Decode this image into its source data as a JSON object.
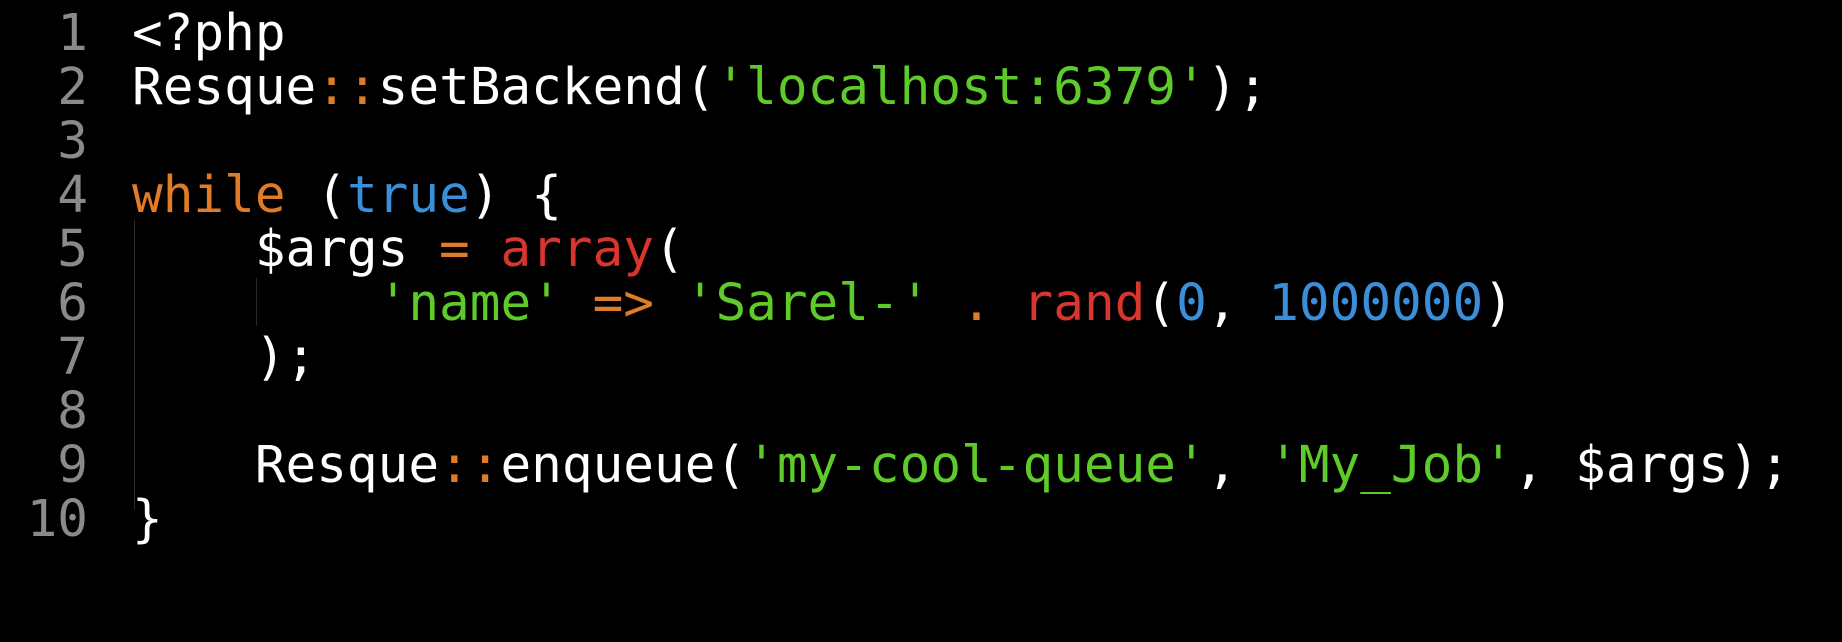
{
  "editor": {
    "colors": {
      "background": "#000000",
      "line_number": "#8a8a8a",
      "plain": "#ffffff",
      "string": "#5fcb2a",
      "keyword": "#e07b27",
      "constant": "#3a8fd8",
      "builtin_function": "#d8352e",
      "indent_guide": "#2a2a2a"
    },
    "lines": [
      {
        "number": "1",
        "tokens": [
          {
            "text": "<?php",
            "type": "plain"
          }
        ]
      },
      {
        "number": "2",
        "tokens": [
          {
            "text": "Resque",
            "type": "plain"
          },
          {
            "text": "::",
            "type": "op"
          },
          {
            "text": "setBackend(",
            "type": "plain"
          },
          {
            "text": "'localhost:6379'",
            "type": "str"
          },
          {
            "text": ");",
            "type": "plain"
          }
        ]
      },
      {
        "number": "3",
        "tokens": []
      },
      {
        "number": "4",
        "tokens": [
          {
            "text": "while",
            "type": "kw"
          },
          {
            "text": " (",
            "type": "plain"
          },
          {
            "text": "true",
            "type": "bool"
          },
          {
            "text": ") {",
            "type": "plain"
          }
        ]
      },
      {
        "number": "5",
        "tokens": [
          {
            "text": "    $args ",
            "type": "plain"
          },
          {
            "text": "=",
            "type": "op"
          },
          {
            "text": " ",
            "type": "plain"
          },
          {
            "text": "array",
            "type": "func"
          },
          {
            "text": "(",
            "type": "plain"
          }
        ]
      },
      {
        "number": "6",
        "tokens": [
          {
            "text": "        ",
            "type": "plain"
          },
          {
            "text": "'name'",
            "type": "str"
          },
          {
            "text": " ",
            "type": "plain"
          },
          {
            "text": "=>",
            "type": "op"
          },
          {
            "text": " ",
            "type": "plain"
          },
          {
            "text": "'Sarel-'",
            "type": "str"
          },
          {
            "text": " ",
            "type": "plain"
          },
          {
            "text": ".",
            "type": "op"
          },
          {
            "text": " ",
            "type": "plain"
          },
          {
            "text": "rand",
            "type": "func"
          },
          {
            "text": "(",
            "type": "plain"
          },
          {
            "text": "0",
            "type": "num"
          },
          {
            "text": ", ",
            "type": "plain"
          },
          {
            "text": "1000000",
            "type": "num"
          },
          {
            "text": ")",
            "type": "plain"
          }
        ]
      },
      {
        "number": "7",
        "tokens": [
          {
            "text": "    );",
            "type": "plain"
          }
        ]
      },
      {
        "number": "8",
        "tokens": []
      },
      {
        "number": "9",
        "tokens": [
          {
            "text": "    Resque",
            "type": "plain"
          },
          {
            "text": "::",
            "type": "op"
          },
          {
            "text": "enqueue(",
            "type": "plain"
          },
          {
            "text": "'my-cool-queue'",
            "type": "str"
          },
          {
            "text": ", ",
            "type": "plain"
          },
          {
            "text": "'My_Job'",
            "type": "str"
          },
          {
            "text": ", $args);",
            "type": "plain"
          }
        ]
      },
      {
        "number": "10",
        "tokens": [
          {
            "text": "}",
            "type": "plain"
          }
        ]
      }
    ]
  }
}
